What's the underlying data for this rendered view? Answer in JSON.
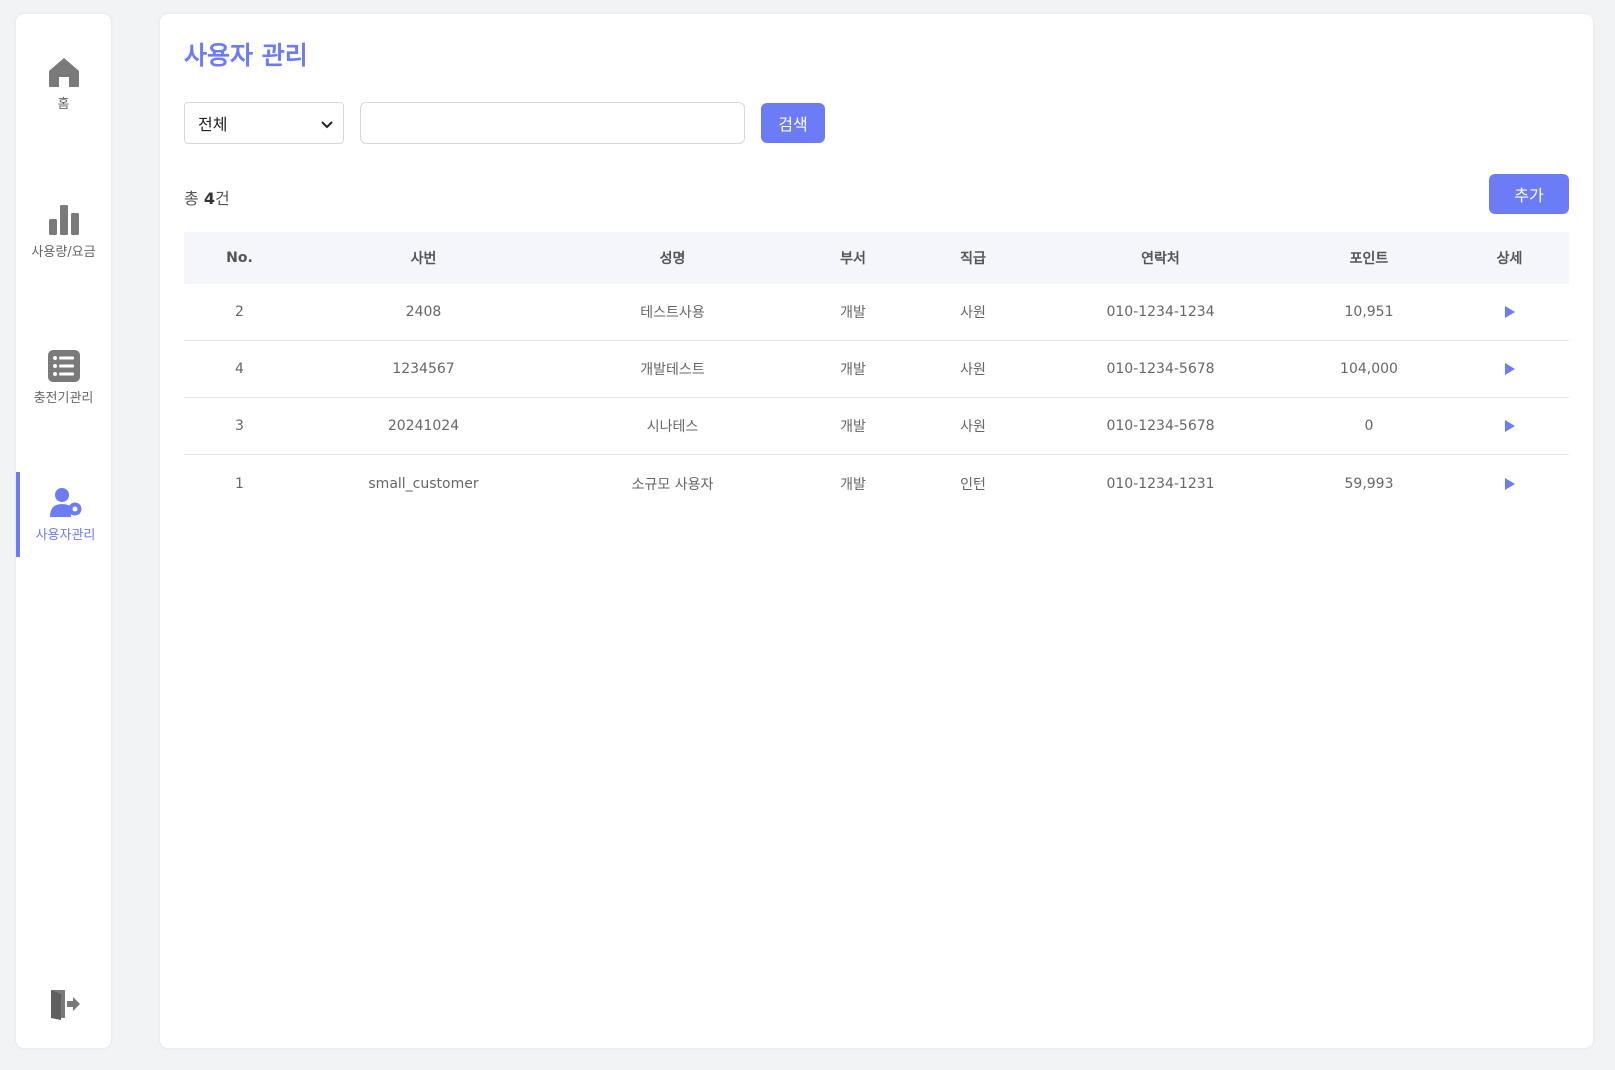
{
  "sidebar": {
    "items": [
      {
        "label": "홈",
        "icon": "home-icon"
      },
      {
        "label": "사용량/요금",
        "icon": "bar-chart-icon"
      },
      {
        "label": "충전기관리",
        "icon": "list-icon"
      },
      {
        "label": "사용자관리",
        "icon": "user-settings-icon",
        "active": true
      }
    ],
    "logout_icon": "logout-icon"
  },
  "main": {
    "title": "사용자 관리",
    "filter": {
      "selected": "전체"
    },
    "search": {
      "value": "",
      "button_label": "검색"
    },
    "total": {
      "prefix": "총 ",
      "count": "4",
      "suffix": "건"
    },
    "add_button_label": "추가",
    "table": {
      "headers": [
        "No.",
        "사번",
        "성명",
        "부서",
        "직급",
        "연락처",
        "포인트",
        "상세"
      ],
      "rows": [
        [
          "2",
          "2408",
          "테스트사용",
          "개발",
          "사원",
          "010-1234-1234",
          "10,951"
        ],
        [
          "4",
          "1234567",
          "개발테스트",
          "개발",
          "사원",
          "010-1234-5678",
          "104,000"
        ],
        [
          "3",
          "20241024",
          "시나테스",
          "개발",
          "사원",
          "010-1234-5678",
          "0"
        ],
        [
          "1",
          "small_customer",
          "소규모 사용자",
          "개발",
          "인턴",
          "010-1234-1231",
          "59,993"
        ]
      ]
    }
  },
  "colors": {
    "accent": "#6c7cf6",
    "icon_gray": "#7a7a7a"
  }
}
